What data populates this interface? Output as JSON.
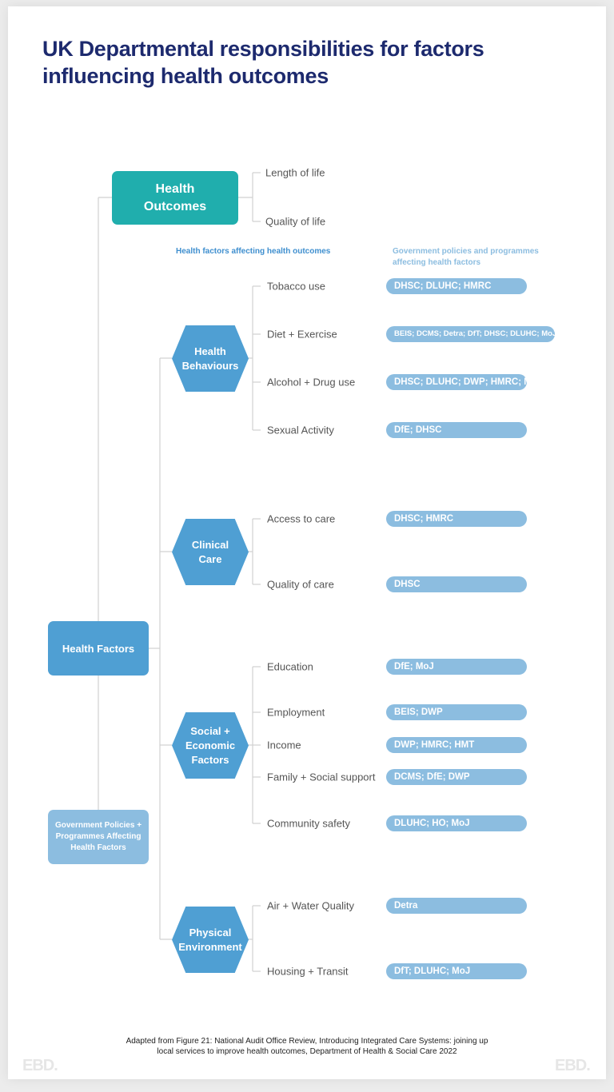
{
  "title": "UK Departmental responsibilities for factors influencing health outcomes",
  "health_outcomes": {
    "label": "Health Outcomes",
    "items": [
      "Length of life",
      "Quality of life"
    ]
  },
  "headers": {
    "factors": "Health factors affecting health outcomes",
    "policies": "Government policies and programmes affecting health factors"
  },
  "health_factors_label": "Health Factors",
  "policies_label": "Government Policies + Programmes Affecting Health Factors",
  "groups": [
    {
      "label": "Health Behaviours",
      "items": [
        {
          "label": "Tobacco use",
          "departments": "DHSC; DLUHC; HMRC"
        },
        {
          "label": "Diet + Exercise",
          "departments": "BEIS; DCMS; Detra; DfT; DHSC; DLUHC; MoJ"
        },
        {
          "label": "Alcohol + Drug use",
          "departments": "DHSC; DLUHC; DWP; HMRC; MoJ"
        },
        {
          "label": "Sexual Activity",
          "departments": "DfE; DHSC"
        }
      ]
    },
    {
      "label": "Clinical Care",
      "items": [
        {
          "label": "Access to care",
          "departments": "DHSC; HMRC"
        },
        {
          "label": "Quality of care",
          "departments": "DHSC"
        }
      ]
    },
    {
      "label": "Social + Economic Factors",
      "items": [
        {
          "label": "Education",
          "departments": "DfE; MoJ"
        },
        {
          "label": "Employment",
          "departments": "BEIS; DWP"
        },
        {
          "label": "Income",
          "departments": "DWP; HMRC; HMT"
        },
        {
          "label": "Family + Social support",
          "departments": "DCMS; DfE; DWP"
        },
        {
          "label": "Community safety",
          "departments": "DLUHC; HO; MoJ"
        }
      ]
    },
    {
      "label": "Physical Environment",
      "items": [
        {
          "label": "Air + Water Quality",
          "departments": "Detra"
        },
        {
          "label": "Housing + Transit",
          "departments": "DfT; DLUHC; MoJ"
        }
      ]
    }
  ],
  "credit": "Adapted from Figure 21: National Audit Office Review, Introducing Integrated Care Systems: joining up local services to improve health outcomes, Department of Health & Social Care 2022",
  "logo": "EBD.",
  "colors": {
    "title": "#1d2a6e",
    "outcomes": "#20aead",
    "factors": "#4f9fd3",
    "policies": "#8cbde0",
    "lines": "#d0d0d0"
  }
}
